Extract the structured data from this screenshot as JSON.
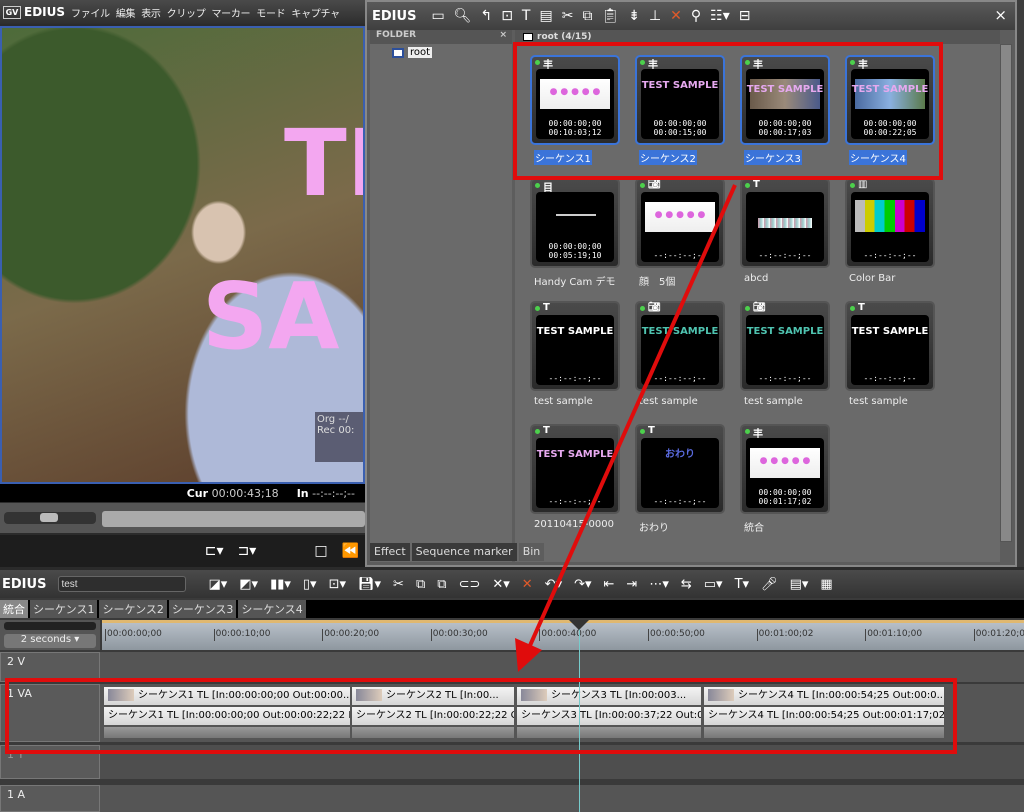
{
  "app": {
    "brand": "EDIUS",
    "menu": [
      "ファイル",
      "編集",
      "表示",
      "クリップ",
      "マーカー",
      "モード",
      "キャプチャ"
    ]
  },
  "preview": {
    "overlay_lines": [
      "TE",
      "SA"
    ],
    "tc_org": "Org --/",
    "tc_rec": "Rec 00:",
    "cur_label": "Cur",
    "cur_value": "00:00:43;18",
    "in_label": "In",
    "in_value": "--:--:--;--"
  },
  "bin": {
    "title": "EDIUS",
    "close": "×",
    "folder_header": "FOLDER",
    "folder_close": "×",
    "folder_root": "root",
    "path": "root (4/15)",
    "tabs": [
      "Effect",
      "Sequence marker",
      "Bin"
    ],
    "items": [
      {
        "name": "シーケンス1",
        "icon": "sequence-icon",
        "type": "seq",
        "tc": [
          "00:00:00;00",
          "00:10:03;12"
        ],
        "selected": true
      },
      {
        "name": "シーケンス2",
        "icon": "sequence-icon",
        "type": "title",
        "text": "TEST SAMPLE",
        "color": "#e6a9ef",
        "tc": [
          "00:00:00;00",
          "00:00:15;00"
        ],
        "selected": true
      },
      {
        "name": "シーケンス3",
        "icon": "sequence-icon",
        "type": "video",
        "text": "TEST SAMPLE",
        "color": "#e6a9ef",
        "tc": [
          "00:00:00;00",
          "00:00:17;03"
        ],
        "selected": true
      },
      {
        "name": "シーケンス4",
        "icon": "sequence-icon",
        "type": "video2",
        "text": "TEST SAMPLE",
        "color": "#e6a9ef",
        "tc": [
          "00:00:00;00",
          "00:00:22;05"
        ],
        "selected": true
      },
      {
        "name": "Handy Cam デモ",
        "icon": "film-icon",
        "type": "dark",
        "tc": [
          "00:00:00;00",
          "00:05:19;10"
        ]
      },
      {
        "name": "顔　5個",
        "icon": "camera-icon",
        "type": "seq",
        "tc": [
          "--:--:--;--"
        ]
      },
      {
        "name": "abcd",
        "icon": "title-icon",
        "type": "abcd",
        "tc": [
          "--:--:--;--"
        ]
      },
      {
        "name": "Color Bar",
        "icon": "colorbar-icon",
        "type": "bars",
        "tc": [
          "--:--:--;--"
        ]
      },
      {
        "name": "test sample",
        "icon": "title-icon",
        "type": "title",
        "text": "TEST SAMPLE",
        "color": "#ffffff",
        "tc": [
          "--:--:--;--"
        ]
      },
      {
        "name": "test sample",
        "icon": "camera-icon",
        "type": "title",
        "text": "TEST SAMPLE",
        "color": "#4fc3b0",
        "tc": [
          "--:--:--;--"
        ]
      },
      {
        "name": "test sample",
        "icon": "camera-icon",
        "type": "title",
        "text": "TEST SAMPLE",
        "color": "#4fc3b0",
        "tc": [
          "--:--:--;--"
        ]
      },
      {
        "name": "test sample",
        "icon": "title-icon",
        "type": "title",
        "text": "TEST SAMPLE",
        "color": "#ffffff",
        "tc": [
          "--:--:--;--"
        ]
      },
      {
        "name": "20110415-0000",
        "icon": "title-icon",
        "type": "title",
        "text": "TEST SAMPLE",
        "color": "#e6a9ef",
        "tc": [
          "--:--:--;--"
        ]
      },
      {
        "name": "おわり",
        "icon": "title-icon",
        "type": "title",
        "text": "おわり",
        "color": "#5a6be0",
        "tc": [
          "--:--:--;--"
        ]
      },
      {
        "name": "統合",
        "icon": "sequence-icon",
        "type": "seq",
        "tc": [
          "00:00:00;00",
          "00:01:17;02"
        ]
      }
    ]
  },
  "timeline": {
    "brand": "EDIUS",
    "project": "test",
    "tabs": [
      "統合",
      "シーケンス1",
      "シーケンス2",
      "シーケンス3",
      "シーケンス4"
    ],
    "active_tab": 0,
    "zoom": "2 seconds",
    "ruler": [
      "00:00:00;00",
      "00:00:10;00",
      "00:00:20;00",
      "00:00:30;00",
      "00:00:40;00",
      "00:00:50;00",
      "00:01:00;02",
      "00:01:10;00",
      "00:01:20;00"
    ],
    "playhead": "00:00:43;18",
    "tracks": [
      "2 V",
      "1 VA",
      "1 T",
      "1 A"
    ],
    "video_clips": [
      "シーケンス1   TL [In:00:00:00;00 Out:00:00...",
      "シーケンス2   TL [In:00...",
      "シーケンス3   TL [In:00:003...",
      "シーケンス4   TL [In:00:00:54;25 Out:00:0..."
    ],
    "audio_clips": [
      "シーケンス1   TL [In:00:00:00;00 Out:00:00:22;22 Dur:...",
      "シーケンス2   TL [In:00:00:22;22 O...",
      "シーケンス3   TL [In:00:00:37;22 Out:00:...",
      "シーケンス4   TL [In:00:00:54;25 Out:00:01:17;02 Du..."
    ]
  },
  "annotation_color": "#e00c0c"
}
